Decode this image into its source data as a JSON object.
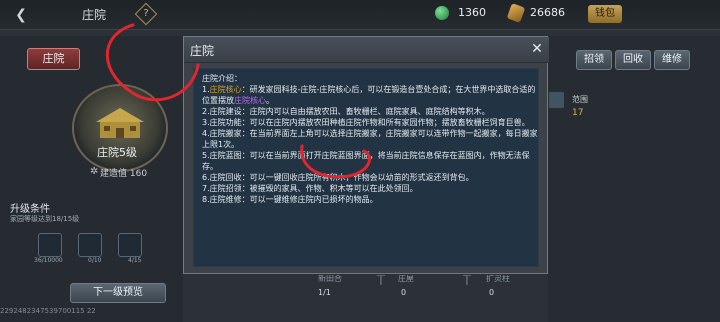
{
  "topbar": {
    "back_icon": "back-arrow-icon",
    "title": "庄院",
    "help_label": "?",
    "currency1": {
      "icon": "jade-icon",
      "value": "1360"
    },
    "currency2": {
      "icon": "coin-icon",
      "value": "26686"
    },
    "wallet_label": "钱包"
  },
  "left_panel": {
    "tab_label": "庄院",
    "level_label": "庄院5级",
    "build_value": "建造值 160",
    "upgrade_title": "升级条件",
    "upgrade_desc": "家园等级达到18/15级",
    "items": [
      {
        "icon": "item-gold-icon",
        "count": "36/10000"
      },
      {
        "icon": "item-grey-icon",
        "count": "0/10"
      },
      {
        "icon": "item-green-icon",
        "count": "4/15"
      }
    ],
    "preview_label": "下一级预览",
    "footer_id": "2292482347539700115 22"
  },
  "right_panel": {
    "buttons": [
      "招领",
      "回收",
      "维修"
    ],
    "range_label": "范围",
    "range_value": "17"
  },
  "bottom": {
    "partial_labels": [
      "新田合",
      "庄屋",
      "扩灵柱"
    ],
    "counts": [
      "1/1",
      "0",
      "0"
    ]
  },
  "dialog": {
    "title": "庄院",
    "lines": [
      {
        "pre": "庄院介绍：",
        "hl": "",
        "post": ""
      },
      {
        "pre": "1.",
        "hl": "庄院核心",
        "post": "：研发家园科技-庄院-庄院核心后，可以在锻造台壹处合成；在大世界中选取合适的位置摆放",
        "hl2": "庄院核心",
        "tail": "。"
      },
      {
        "pre": "2.庄院建设：庄院内可以自由摆放农田、畜牧栅栏、庭院家具、庭院结构等积木。",
        "hl": "",
        "post": ""
      },
      {
        "pre": "3.庄院功能：可以在庄院内摆放农田种植庄院作物和所有家园作物；摆放畜牧栅栏饲育巨兽。",
        "hl": "",
        "post": ""
      },
      {
        "pre": "4.庄院搬家：在当前界面左上角可以选择庄院搬家，庄院搬家可以连带作物一起搬家，每日搬家上限1次。",
        "hl": "",
        "post": ""
      },
      {
        "pre": "5.庄院蓝图：可以在当前界面打开庄院蓝图界面，将当前庄院信息保存在蓝图内，作物无法保存。",
        "hl": "",
        "post": ""
      },
      {
        "pre": "6.庄院回收：可以一键回收庄院所有积木，作物会以幼苗的形式返还到背包。",
        "hl": "",
        "post": ""
      },
      {
        "pre": "7.庄院招领：被摧毁的家具、作物、积木等可以在此处领回。",
        "hl": "",
        "post": ""
      },
      {
        "pre": "8.庄院维修：可以一键维修庄院内已损坏的物品。",
        "hl": "",
        "post": ""
      }
    ],
    "close_icon": "close-icon"
  },
  "colors": {
    "highlight": "#d8a12c",
    "highlight2": "#b46df3",
    "annotation": "#e0262f"
  }
}
